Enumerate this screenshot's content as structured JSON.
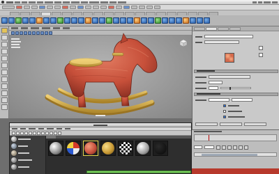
{
  "colors": {
    "horse_body": "#c8513d",
    "rocker_wood": "#d9b04a",
    "viewport_bg": "#9a9a9a",
    "highlight_bar": "#7bd35e",
    "error_bar": "#b7392c"
  },
  "icons": [
    "apple-icon",
    "shelf-tool-icon",
    "view-cube-icon",
    "play-icon",
    "material-sphere-icon"
  ]
}
